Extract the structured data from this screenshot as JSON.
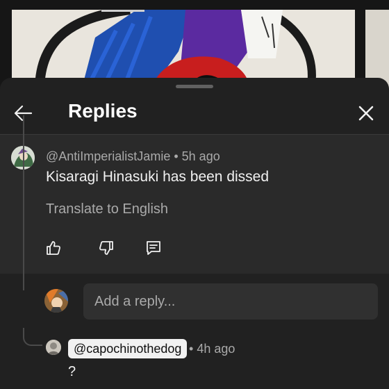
{
  "header": {
    "title": "Replies",
    "back_icon": "arrow-left-icon",
    "close_icon": "close-icon"
  },
  "parent_comment": {
    "author": "@AntiImperialistJamie",
    "time": "5h ago",
    "text": "Kisaragi Hinasuki has been dissed",
    "translate_label": "Translate to English",
    "actions": [
      "like-icon",
      "dislike-icon",
      "reply-icon"
    ]
  },
  "reply_box": {
    "placeholder": "Add a reply..."
  },
  "reply": {
    "author": "@capochinothedog",
    "time": "4h ago",
    "text": "?"
  },
  "colors": {
    "sheet_background": "#212121",
    "highlight_background": "#2a2a2a",
    "secondary_text": "#aaaaaa",
    "primary_text": "#f1f1f1",
    "chip_background": "#f1f1f1"
  }
}
